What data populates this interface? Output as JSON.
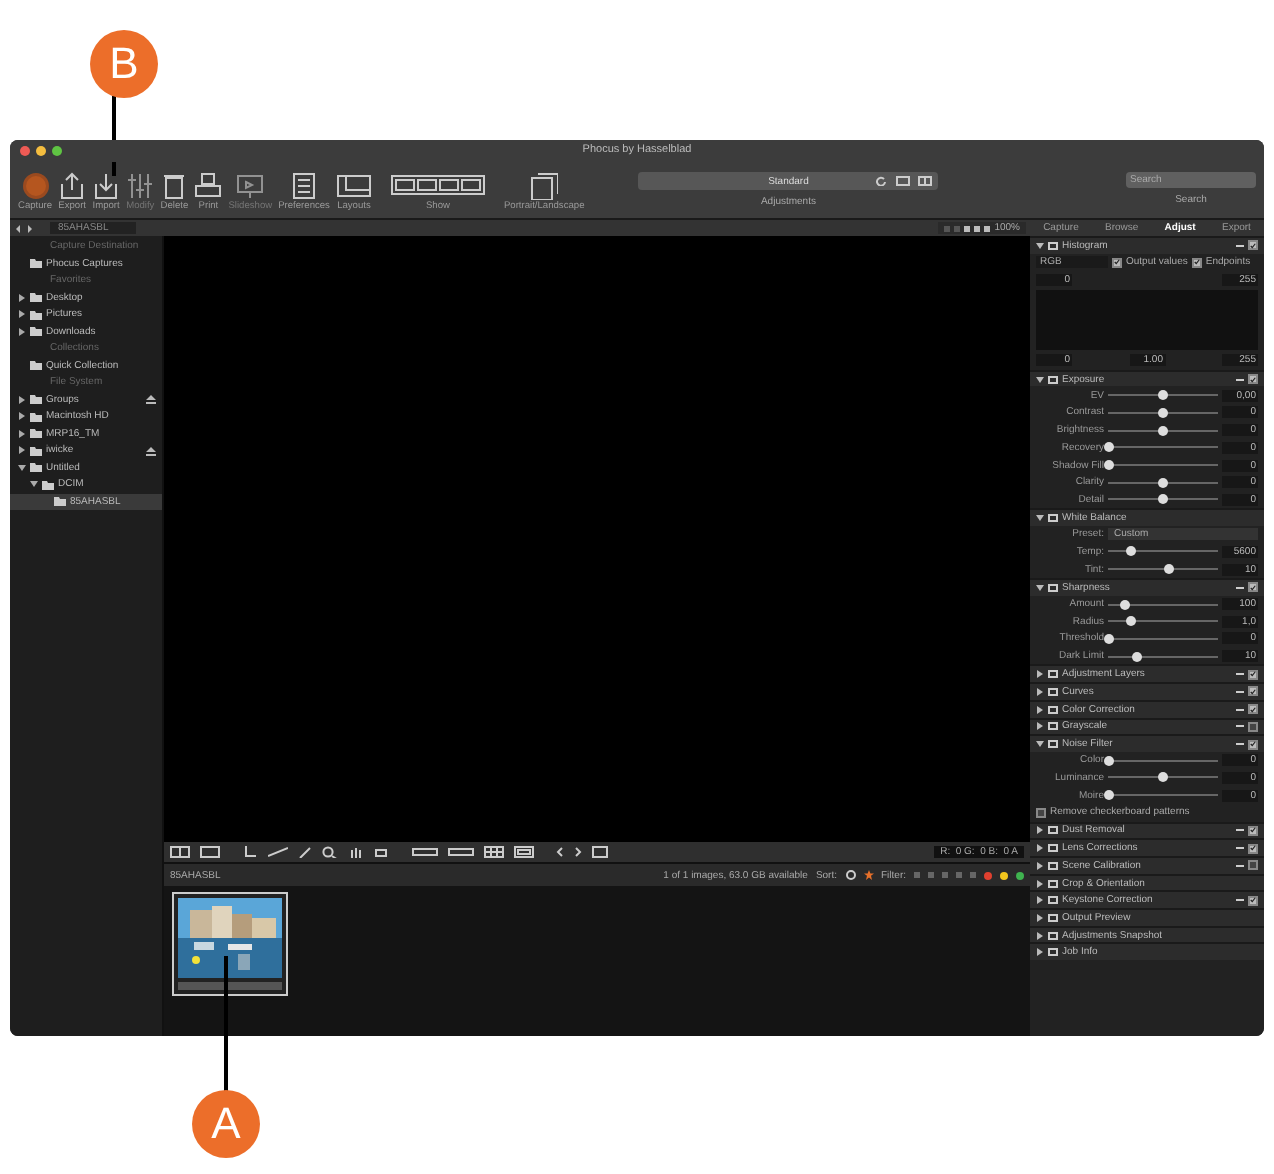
{
  "callouts": [
    {
      "label": "B"
    },
    {
      "label": "A"
    }
  ],
  "window": {
    "title": "Phocus by Hasselblad"
  },
  "toolbar": {
    "tools": [
      {
        "label": "Capture",
        "kind": "record",
        "disabled": false
      },
      {
        "label": "Export",
        "kind": "export",
        "disabled": false
      },
      {
        "label": "Import",
        "kind": "import",
        "disabled": false
      },
      {
        "label": "Modify",
        "kind": "modify",
        "disabled": true
      },
      {
        "label": "Delete",
        "kind": "delete",
        "disabled": false
      },
      {
        "label": "Print",
        "kind": "print",
        "disabled": false
      },
      {
        "label": "Slideshow",
        "kind": "slideshow",
        "disabled": true
      },
      {
        "label": "Preferences",
        "kind": "preferences",
        "disabled": false
      },
      {
        "label": "Layouts",
        "kind": "layouts",
        "disabled": false
      },
      {
        "label": "Show",
        "kind": "show",
        "disabled": false
      },
      {
        "label": "Portrait/Landscape",
        "kind": "portrait",
        "disabled": false
      }
    ],
    "preset": "Standard",
    "adjustments_label": "Adjustments",
    "search": {
      "placeholder": "Search",
      "label": "Search"
    }
  },
  "browser_bar": {
    "folder": "85AHASBL"
  },
  "viewer_bar": {
    "zoom": "100%"
  },
  "sidebar": [
    {
      "heading": "Capture Destination",
      "items": [
        {
          "label": "Phocus Captures",
          "selected": false
        }
      ]
    },
    {
      "heading": "Favorites",
      "items": [
        {
          "label": "Desktop",
          "expanded": false,
          "selected": false
        },
        {
          "label": "Pictures",
          "expanded": false,
          "selected": false
        },
        {
          "label": "Downloads",
          "expanded": false,
          "selected": false
        }
      ]
    },
    {
      "heading": "Collections",
      "items": [
        {
          "label": "Quick Collection",
          "selected": false
        }
      ]
    },
    {
      "heading": "File System",
      "items": [
        {
          "label": "Groups",
          "expanded": false,
          "ejectable": true,
          "selected": false
        },
        {
          "label": "Macintosh HD",
          "expanded": false,
          "selected": false
        },
        {
          "label": "MRP16_TM",
          "expanded": false,
          "selected": false
        },
        {
          "label": "iwicke",
          "expanded": false,
          "ejectable": true,
          "selected": false
        },
        {
          "label": "Untitled",
          "expanded": true,
          "selected": false,
          "children": [
            {
              "label": "DCIM",
              "expanded": true,
              "selected": false,
              "children": [
                {
                  "label": "85AHASBL",
                  "selected": true
                }
              ]
            }
          ]
        }
      ]
    }
  ],
  "panel_tabs": [
    {
      "label": "Capture",
      "selected": false
    },
    {
      "label": "Browse",
      "selected": false
    },
    {
      "label": "Adjust",
      "selected": true
    },
    {
      "label": "Export",
      "selected": false
    }
  ],
  "sections": [
    {
      "kind": "histogram",
      "title": "Histogram",
      "expanded": true,
      "checked": true,
      "channel": "RGB",
      "options": [
        {
          "label": "Output values",
          "checked": true
        },
        {
          "label": "Endpoints",
          "checked": true
        }
      ],
      "input_range": [
        "0",
        "255"
      ],
      "output_range": [
        "0",
        "1.00",
        "255"
      ]
    },
    {
      "kind": "sliders",
      "title": "Exposure",
      "expanded": true,
      "checked": true,
      "sliders": [
        {
          "label": "EV",
          "level": 0.5,
          "value": "0,00"
        },
        {
          "label": "Contrast",
          "level": 0.5,
          "value": "0"
        },
        {
          "label": "Brightness",
          "level": 0.5,
          "value": "0"
        },
        {
          "label": "Recovery",
          "level": 0,
          "value": "0"
        },
        {
          "label": "Shadow Fill",
          "level": 0,
          "value": "0"
        },
        {
          "label": "Clarity",
          "level": 0.5,
          "value": "0"
        },
        {
          "label": "Detail",
          "level": 0.5,
          "value": "0"
        }
      ]
    },
    {
      "kind": "sliders",
      "title": "White Balance",
      "expanded": true,
      "preset_label": "Preset:",
      "preset": "Custom",
      "sliders": [
        {
          "label": "Temp:",
          "level": 0.2,
          "value": "5600"
        },
        {
          "label": "Tint:",
          "level": 0.55,
          "value": "10"
        }
      ]
    },
    {
      "kind": "sliders",
      "title": "Sharpness",
      "expanded": true,
      "checked": true,
      "sliders": [
        {
          "label": "Amount",
          "level": 0.15,
          "value": "100"
        },
        {
          "label": "Radius",
          "level": 0.2,
          "value": "1,0"
        },
        {
          "label": "Threshold",
          "level": 0,
          "value": "0"
        },
        {
          "label": "Dark Limit",
          "level": 0.27,
          "value": "10"
        }
      ]
    },
    {
      "title": "Adjustment Layers",
      "expanded": false,
      "checked": true
    },
    {
      "title": "Curves",
      "expanded": false,
      "checked": true
    },
    {
      "title": "Color Correction",
      "expanded": false,
      "checked": true
    },
    {
      "title": "Grayscale",
      "expanded": false,
      "checked": false
    },
    {
      "kind": "sliders",
      "title": "Noise Filter",
      "expanded": true,
      "checked": true,
      "sliders": [
        {
          "label": "Color",
          "level": 0,
          "value": "0"
        },
        {
          "label": "Luminance",
          "level": 0.5,
          "value": "0"
        },
        {
          "label": "Moire",
          "level": 0,
          "value": "0"
        }
      ],
      "option": {
        "label": "Remove checkerboard patterns",
        "checked": false
      }
    },
    {
      "title": "Dust Removal",
      "expanded": false,
      "checked": true
    },
    {
      "title": "Lens Corrections",
      "expanded": false,
      "checked": true
    },
    {
      "title": "Scene Calibration",
      "expanded": false,
      "checked": false
    },
    {
      "title": "Crop & Orientation",
      "expanded": false
    },
    {
      "title": "Keystone Correction",
      "expanded": false,
      "checked": true
    },
    {
      "title": "Output Preview",
      "expanded": false
    },
    {
      "title": "Adjustments Snapshot",
      "expanded": false
    },
    {
      "title": "Job Info",
      "expanded": false
    }
  ],
  "viewer_tools": {
    "readout": "R:  0 G:  0 B:  0 A"
  },
  "strip": {
    "folder": "85AHASBL",
    "info": "1 of 1 images, 63.0 GB available",
    "sort_label": "Sort:",
    "filter_label": "Filter:",
    "filter_colors": [
      {
        "color": "#e0402f"
      },
      {
        "color": "#f2c51d"
      },
      {
        "color": "#3fb34f"
      }
    ],
    "thumbnails": [
      {
        "kind": "picture",
        "selected": true
      }
    ]
  }
}
